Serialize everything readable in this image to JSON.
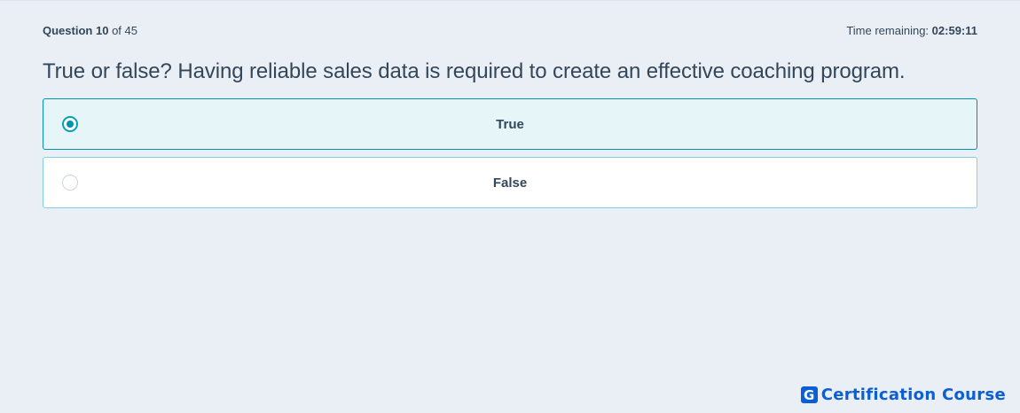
{
  "header": {
    "question_label": "Question",
    "question_number": "10",
    "question_of": "of 45",
    "time_label": "Time remaining:",
    "time_value": "02:59:11"
  },
  "question": {
    "text": "True or false? Having reliable sales data is required to create an effective coaching program."
  },
  "options": [
    {
      "label": "True",
      "selected": true
    },
    {
      "label": "False",
      "selected": false
    }
  ],
  "brand": {
    "logo_letter": "G",
    "name": "Certification Course",
    "color": "#0a5fd6"
  },
  "colors": {
    "background": "#eaeff5",
    "text": "#33475b",
    "selected_fill": "#e5f5f8",
    "selected_border": "#0091ae",
    "option_border": "#7fd1de"
  }
}
